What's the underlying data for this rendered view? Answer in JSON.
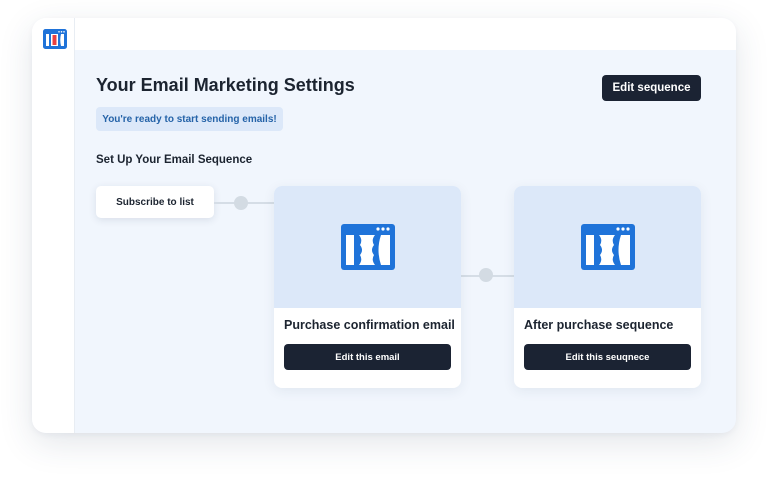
{
  "header": {
    "title": "Your Email Marketing Settings",
    "edit_sequence_label": "Edit sequence"
  },
  "status": {
    "message": "You're ready to start sending emails!"
  },
  "sequence": {
    "heading": "Set Up Your Email Sequence",
    "trigger_label": "Subscribe to list",
    "steps": [
      {
        "title": "Purchase confirmation email",
        "button_label": "Edit this email"
      },
      {
        "title": "After purchase sequence",
        "button_label": "Edit this seuqnece"
      }
    ]
  },
  "colors": {
    "accent": "#1f73d9",
    "dark_button": "#1b2333",
    "thumb_bg": "#dce8f9",
    "page_bg": "#f1f6fd",
    "logo_red": "#e94040"
  },
  "icons": {
    "sidebar_logo": "clickfunnels-logo-icon",
    "card_logo": "clickfunnels-logo-icon"
  }
}
